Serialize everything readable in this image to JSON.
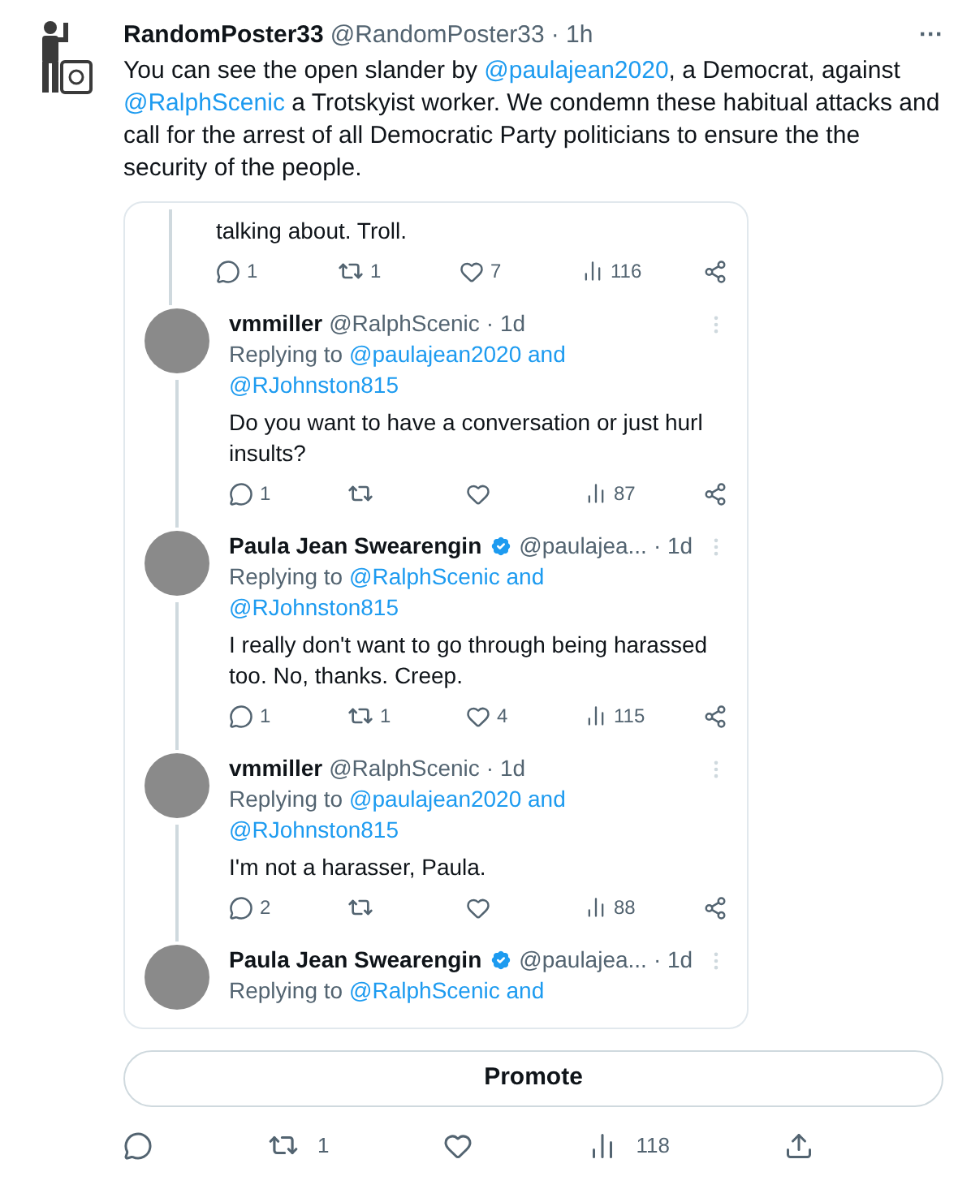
{
  "post": {
    "author": "RandomPoster33",
    "handle": "@RandomPoster33",
    "time": "· 1h",
    "more": "···",
    "text": [
      {
        "kind": "plain",
        "text": "You can see the open slander by "
      },
      {
        "kind": "mention",
        "text": "@paulajean2020"
      },
      {
        "kind": "plain",
        "text": ", a Democrat, against "
      },
      {
        "kind": "mention",
        "text": "@RalphScenic"
      },
      {
        "kind": "plain",
        "text": " a Trotskyist worker. We condemn these habitual attacks and call for the arrest of all Democratic Party politicians to ensure the the security of the people."
      }
    ]
  },
  "embedded": {
    "replies": [
      {
        "kind": "partial",
        "text": "talking about. Troll.",
        "counts": {
          "reply": "1",
          "repost": "1",
          "like": "7",
          "views": "116"
        }
      },
      {
        "kind": "full",
        "author": "vmmiller",
        "verified": false,
        "handle": "@RalphScenic",
        "time": "· 1d",
        "replying_label": "Replying to",
        "replying_to": [
          "@paulajean2020 and",
          "@RJohnston815"
        ],
        "text": "Do you want to have a conversation or just hurl insults?",
        "counts": {
          "reply": "1",
          "views": "87"
        }
      },
      {
        "kind": "full",
        "author": "Paula Jean Swearengin",
        "verified": true,
        "handle": "@paulajea...",
        "time": "· 1d",
        "replying_label": "Replying to",
        "replying_to": [
          "@RalphScenic and",
          "@RJohnston815"
        ],
        "text": "I really don't want to go through being harassed too. No, thanks. Creep.",
        "counts": {
          "reply": "1",
          "repost": "1",
          "like": "4",
          "views": "115"
        }
      },
      {
        "kind": "full",
        "author": "vmmiller",
        "verified": false,
        "handle": "@RalphScenic",
        "time": "· 1d",
        "replying_label": "Replying to",
        "replying_to": [
          "@paulajean2020 and",
          "@RJohnston815"
        ],
        "text": "I'm not a harasser, Paula.",
        "counts": {
          "reply": "2",
          "views": "88"
        }
      },
      {
        "kind": "cut",
        "author": "Paula Jean Swearengin",
        "verified": true,
        "handle": "@paulajea...",
        "time": "· 1d",
        "replying_label": "Replying to",
        "replying_to": [
          "@RalphScenic and"
        ]
      }
    ]
  },
  "promote": "Promote",
  "actions": {
    "repost": "1",
    "views": "118"
  }
}
